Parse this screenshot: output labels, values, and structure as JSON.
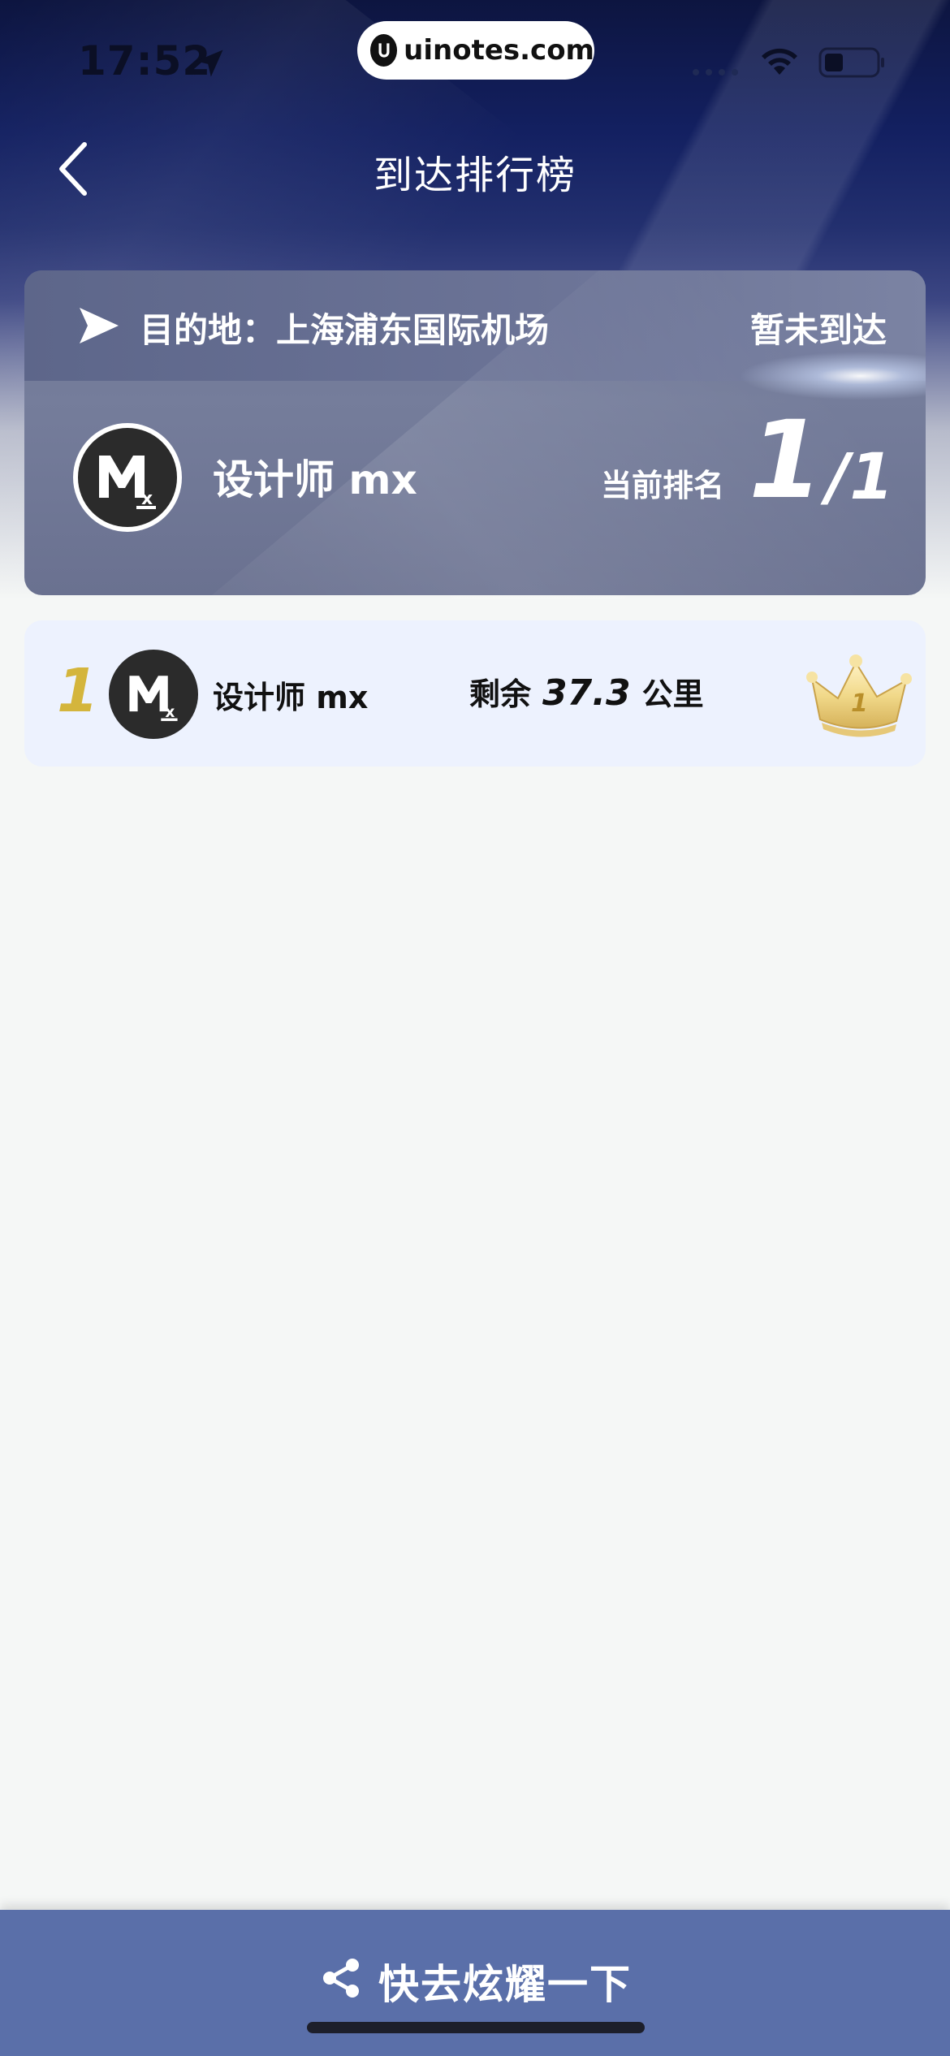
{
  "status_bar": {
    "time": "17:52",
    "watermark": "uinotes.com"
  },
  "header": {
    "title": "到达排行榜"
  },
  "destination_card": {
    "destination_label": "目的地：上海浦东国际机场",
    "arrival_status": "暂未到达",
    "user_name": "设计师 mx",
    "rank_label": "当前排名",
    "rank_current": "1",
    "rank_separator": "/",
    "rank_total": "1"
  },
  "leaderboard": [
    {
      "rank": "1",
      "name": "设计师 mx",
      "remaining_label": "剩余",
      "remaining_value": "37.3",
      "unit": "公里",
      "badge_icon": "crown-icon"
    }
  ],
  "bottom": {
    "share_label": "快去炫耀一下"
  },
  "colors": {
    "rank_gold": "#d4b53c",
    "bottom_bar": "#5a6fa9",
    "row_background": "#edf2fe",
    "page_background": "#f5f7f6"
  }
}
